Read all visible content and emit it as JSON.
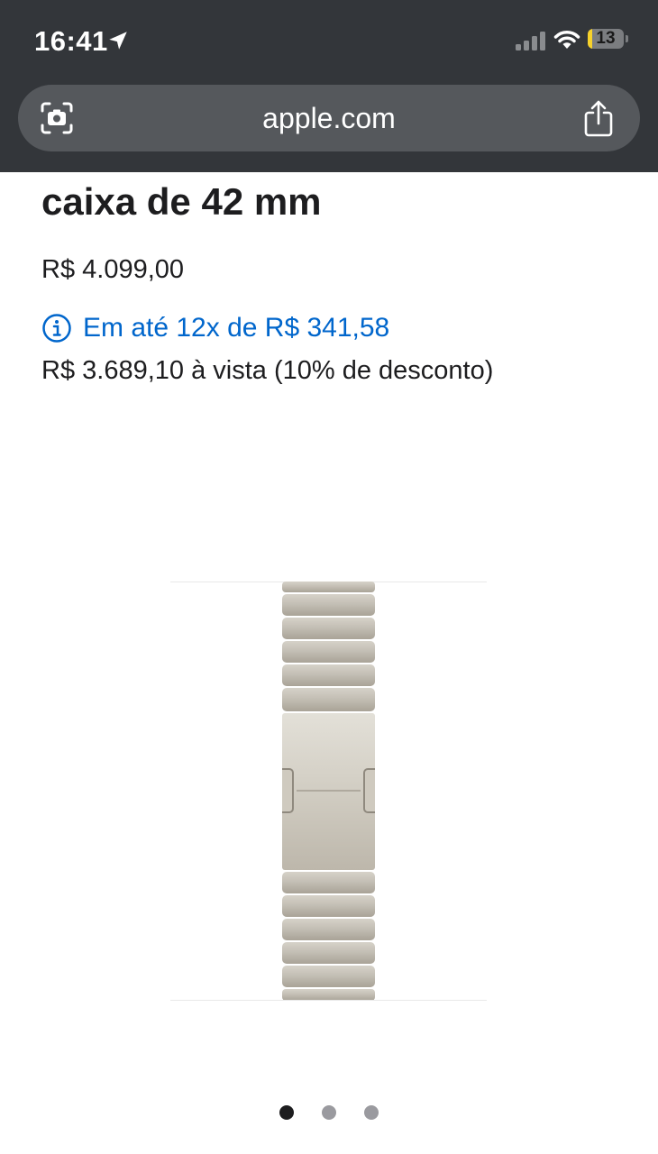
{
  "status_bar": {
    "time": "16:41",
    "battery_level": "13",
    "battery_fraction": 0.13,
    "icons": [
      "location-arrow-icon",
      "cellular-signal-icon",
      "wifi-icon",
      "battery-icon"
    ]
  },
  "browser": {
    "url": "apple.com",
    "icons": [
      "visual-lookup-icon",
      "share-icon"
    ]
  },
  "product": {
    "title": "caixa de 42 mm",
    "price": "R$ 4.099,00",
    "installments": "Em até 12x de R$ 341,58",
    "cash_price": "R$ 3.689,10 à vista (10% de desconto)"
  },
  "gallery": {
    "image": "titanium-link-bracelet",
    "slide_count": 3,
    "active_slide": 1
  },
  "colors": {
    "chrome": "#33363a",
    "address_bar": "#55585c",
    "link": "#0066cc",
    "text": "#1d1d1f",
    "battery_fill": "#f7d22b"
  }
}
